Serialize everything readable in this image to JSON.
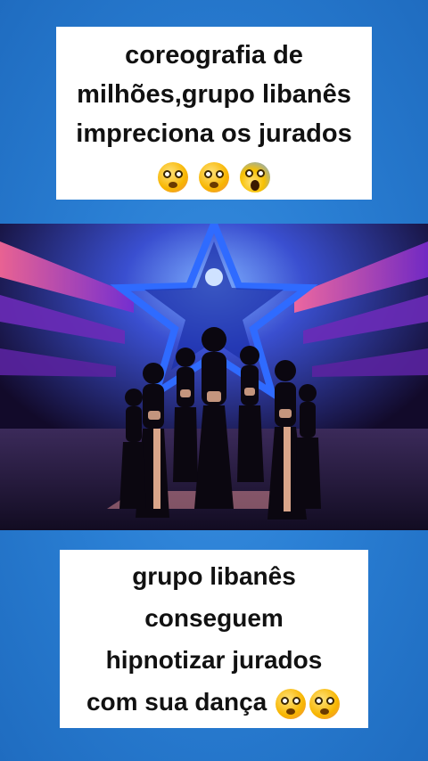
{
  "top_caption": {
    "lines": [
      "coreografia de",
      "milhões,grupo libanês",
      "impreciona os jurados"
    ],
    "emojis": [
      "flushed-face",
      "flushed-face",
      "face-screaming-in-fear"
    ]
  },
  "bottom_caption": {
    "lines": [
      "grupo libanês",
      "conseguem",
      "hipnotizar jurados",
      "com sua dança"
    ],
    "emojis": [
      "flushed-face",
      "flushed-face"
    ]
  },
  "colors": {
    "background": "#2a7fd4",
    "caption_bg": "#ffffff",
    "caption_text": "#111111",
    "stage_star": "#2f6bff",
    "stage_glow": "#ff3b7a"
  }
}
